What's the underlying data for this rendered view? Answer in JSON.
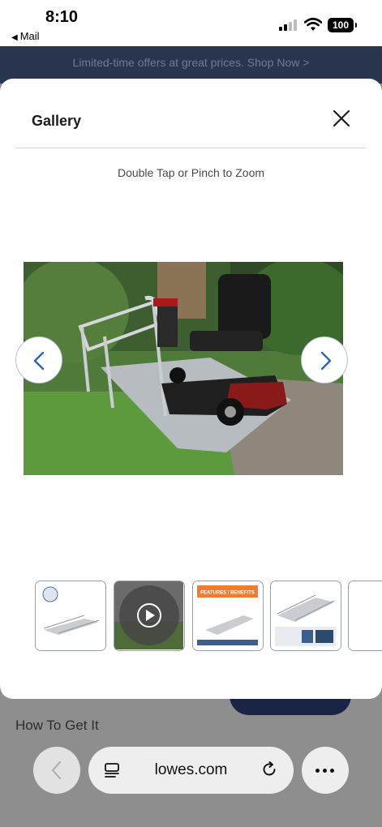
{
  "status_bar": {
    "time": "8:10",
    "back_app": "Mail",
    "battery": "100",
    "icons": [
      "signal-icon",
      "wifi-icon",
      "battery-icon"
    ]
  },
  "promo_banner": {
    "text": "Limited-time offers at great prices. Shop Now >"
  },
  "page": {
    "section_heading": "How To Get It"
  },
  "gallery": {
    "title": "Gallery",
    "zoom_hint": "Double Tap or Pinch to Zoom",
    "close_icon": "close-icon",
    "prev_icon": "chevron-left-icon",
    "next_icon": "chevron-right-icon",
    "thumbnails": [
      {
        "kind": "image"
      },
      {
        "kind": "video"
      },
      {
        "kind": "image",
        "banner_text": "FEATURES / BENEFITS"
      },
      {
        "kind": "image"
      },
      {
        "kind": "image"
      }
    ]
  },
  "browser": {
    "url": "lowes.com",
    "icons": [
      "back-icon",
      "page-menu-icon",
      "reload-icon",
      "more-icon"
    ]
  },
  "colors": {
    "navy": "#1a2545",
    "promo_bg": "#2a3550",
    "arrow_blue": "#2c66b8",
    "feature_orange": "#f07c2f"
  }
}
